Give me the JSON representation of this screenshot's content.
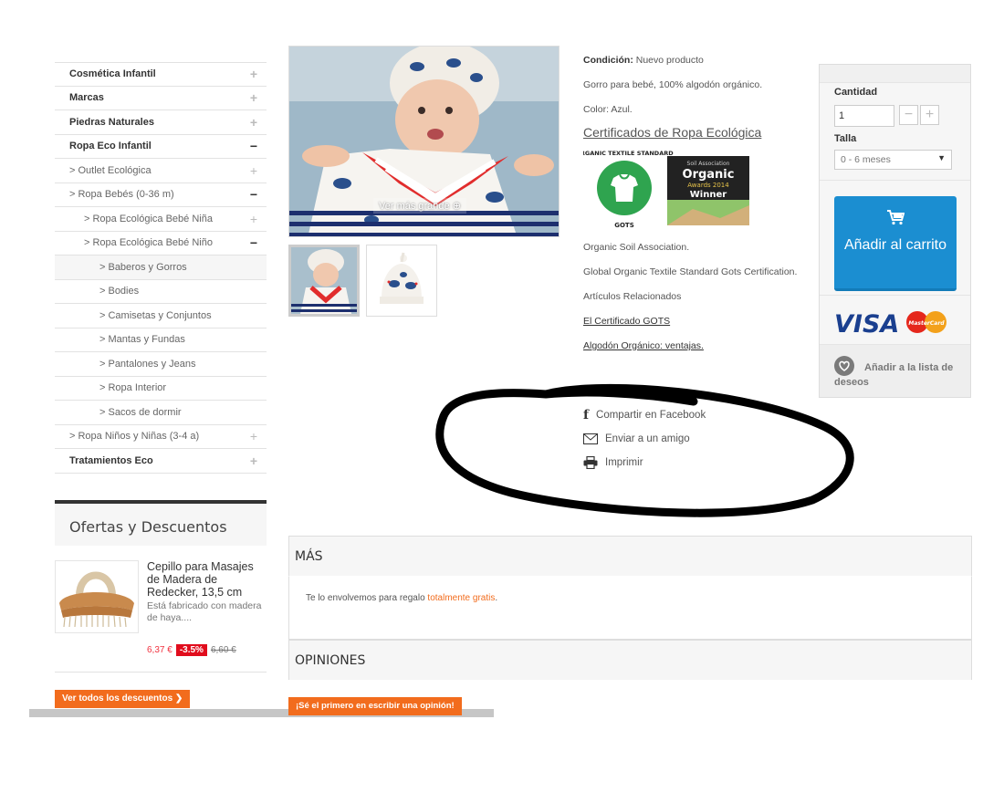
{
  "sidebar": {
    "categories": [
      {
        "label": "Cosmética Infantil",
        "toggle": "+"
      },
      {
        "label": "Marcas",
        "toggle": "+"
      },
      {
        "label": "Piedras Naturales",
        "toggle": "+"
      },
      {
        "label": "Ropa Eco Infantil",
        "toggle": "−"
      },
      {
        "label": "> Outlet Ecológica",
        "toggle": "+"
      },
      {
        "label": "> Ropa Bebés (0-36 m)",
        "toggle": "−"
      },
      {
        "label": "> Ropa Ecológica Bebé Niña",
        "toggle": "+"
      },
      {
        "label": "> Ropa Ecológica Bebé Niño",
        "toggle": "−"
      },
      {
        "label": "> Baberos y Gorros",
        "toggle": ""
      },
      {
        "label": "> Bodies",
        "toggle": ""
      },
      {
        "label": "> Camisetas y Conjuntos",
        "toggle": ""
      },
      {
        "label": "> Mantas y Fundas",
        "toggle": ""
      },
      {
        "label": "> Pantalones y Jeans",
        "toggle": ""
      },
      {
        "label": "> Ropa Interior",
        "toggle": ""
      },
      {
        "label": "> Sacos de dormir",
        "toggle": ""
      },
      {
        "label": "> Ropa Niños y Niñas (3-4 a)",
        "toggle": "+"
      },
      {
        "label": "Tratamientos Eco",
        "toggle": "+"
      }
    ],
    "offers_title": "Ofertas y Descuentos",
    "offer": {
      "name": "Cepillo para Masajes de Madera de Redecker, 13,5 cm",
      "description": "Está fabricado con madera de haya....",
      "price": "6,37 €",
      "discount": "-3.5%",
      "old_price": "6,60 €"
    },
    "see_all_label": "Ver todos los descuentos ❯"
  },
  "product": {
    "view_larger": "Ver más grande ⊕",
    "condition_label": "Condición:",
    "condition_value": "Nuevo producto",
    "description": "Gorro para bebé, 100% algodón orgánico.",
    "color": "Color: Azul.",
    "certificates_link": "Certificados de Ropa Ecológica",
    "badge_gots_top": "ORGANIC TEXTILE STANDARD",
    "badge_gots_bottom": "GOTS",
    "badge_award_1": "Soil Association",
    "badge_award_2": "Organic",
    "badge_award_3": "Awards 2014",
    "badge_award_4": "Winner",
    "soil_association": "Organic Soil Association.",
    "gots_cert": "Global Organic Textile Standard Gots Certification.",
    "related_title": "Artículos Relacionados",
    "related_1": "El Certificado GOTS",
    "related_2": "Algodón Orgánico: ventajas.",
    "share_facebook": "Compartir en Facebook",
    "send_friend": "Enviar a un amigo",
    "print": "Imprimir"
  },
  "buybox": {
    "quantity_label": "Cantidad",
    "quantity_value": "1",
    "size_label": "Talla",
    "size_value": "0 - 6 meses",
    "add_to_cart": "Añadir al carrito",
    "visa": "VISA",
    "mastercard": "MasterCard",
    "wishlist": "Añadir a la lista de deseos"
  },
  "sections": {
    "more_title": "MÁS",
    "more_text": "Te lo envolvemos para regalo ",
    "more_highlight": "totalmente gratis",
    "more_end": ".",
    "reviews_title": "OPINIONES",
    "review_button": "¡Sé el primero en escribir una opinión!"
  },
  "colors": {
    "accent_orange": "#f26c1d",
    "cart_blue": "#1b8ed1",
    "discount_red": "#e10d1d"
  }
}
